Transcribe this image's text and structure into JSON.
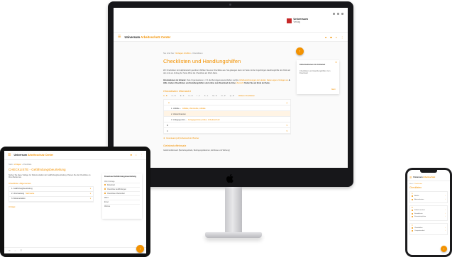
{
  "monitor": {
    "logo": {
      "name": "Universum",
      "sub": "Verlag"
    },
    "header": {
      "brand_name": "Universum",
      "brand_accent": "Arbeitsschutz Center",
      "menu_icon": "burger-icon",
      "icons": [
        "user-icon",
        "cart-icon",
        "search-icon",
        "more-icon"
      ]
    },
    "breadcrumb": {
      "home": "Sie sind hier:",
      "level1": "Vorlagen & Hilfen",
      "sep": " › ",
      "current": "Checklisten"
    },
    "title": "Checklisten und Handlungshilfen",
    "intro": "Wir Checklisten sind alphabetisch geordnet. Wählen Sie eine Checkliste aus. Sie gelangen dann zur Seite mit der zugehörigen Handlungshilfe. Ein Klick auf den Link am Anfang der Seite öffnet die Checkliste als Word-Datei.",
    "info_label": "Informationen im Intranet:",
    "info_text": " Viele Organisationen, z. B. die Berufsgenossenschaften und die ",
    "info_link": "Unfallversicherungen der Länder, bieten eigene Vorlagen an",
    "info_bold": " & Hilfe. Andere Checklisten und Handlungshilfen sind online zum Download da. Eine ",
    "info_link2": "Übersicht",
    "info_tail": " finden Sie am Ende der Seite.",
    "overview_heading": "Checklisten Übersicht",
    "letters": [
      "A - B",
      "C - D",
      "E - F",
      "G - H",
      "I - J",
      "K - L",
      "M - N",
      "O - P",
      "Q - R",
      "Weitere Checklisten"
    ],
    "accordion": [
      {
        "label": "A",
        "type": "header",
        "chevron": "▴"
      },
      {
        "label": "1. Abfälle –",
        "link": "Abfälle, Wertstoffe, Abfälle",
        "type": "sub"
      },
      {
        "label": "2. Absturzkanten",
        "link": "",
        "type": "sub sel"
      },
      {
        "label": "3. Anlegegerüst –",
        "link": "Anlegegerüste prüfen, Arbeitsschutz",
        "type": "sub"
      },
      {
        "label": "B",
        "type": "header",
        "chevron": "▾"
      },
      {
        "label": "C",
        "type": "header",
        "chevron": "▾"
      }
    ],
    "download_label": "Download (pdf) Arbeitsschutz Bücher",
    "section2_heading": "Gefahrstoffeinsatz",
    "section2_text": "Gefahrstoffeinsatz (Betriebsgelände, Bedingungsfaktoren, Einflüsse und Wirkung)",
    "sidebar": {
      "title": "Informationen im Intranet",
      "desc": "Checklisten und Handlungshilfen zum Download",
      "more": "Mehr"
    },
    "fab_icon": "↑"
  },
  "tablet": {
    "brand_name": "Universum",
    "brand_accent": "Arbeitsschutz Center",
    "breadcrumb": {
      "home": "Start",
      "level1": "Vorlagen",
      "current": "Checkliste"
    },
    "title": "CHECKLISTE - Gefährdungsbeurteilung",
    "para": "Nutzen Sie diese Vorlage zur Dokumentation der Gefährdungsbeurteilung. Passen Sie die Checkliste an Ihren Betrieb an.",
    "sec1": "Checkliste: Allgemeines",
    "rows": [
      {
        "label": "1. Gefährdungsbeurteilung",
        "link": "",
        "chev": "▾"
      },
      {
        "label": "2. Unterweisung",
        "link": "Nachweise",
        "chev": "▾"
      },
      {
        "label": "3. Dokumentation",
        "link": "",
        "chev": "▾"
      }
    ],
    "sec2": "Anlage:",
    "sidebar": {
      "title": "Download Gefährdungsbeurteilung",
      "desc": "Word-Vorlage",
      "options": [
        "Download",
        "Checkliste Gefährdungen",
        "Checkliste Arbeitsmittel",
        "Word",
        "Excel",
        "Weitere"
      ]
    },
    "bottom": [
      "✉",
      "⌂",
      "☰"
    ],
    "fab_icon": "↑"
  },
  "phone": {
    "brand_name": "Universum",
    "brand_accent": "Arbeitsschutz",
    "breadcrumb": {
      "home": "Start",
      "current": "Checklisten"
    },
    "title": "Checklisten",
    "cards": [
      {
        "title": "A",
        "rows": [
          "Abfälle",
          "Absturzkanten"
        ]
      },
      {
        "title": "B",
        "rows": [
          "Bildschirmarbeit",
          "Brandschutz",
          "Büroarbeitsplätze"
        ]
      },
      {
        "title": "C",
        "rows": [
          "Chemikalien",
          "Computerarbeit"
        ]
      }
    ],
    "fab_icon": "↑"
  },
  "colors": {
    "accent": "#f39200",
    "logo_red": "#c62828",
    "device_dark": "#17171a"
  }
}
